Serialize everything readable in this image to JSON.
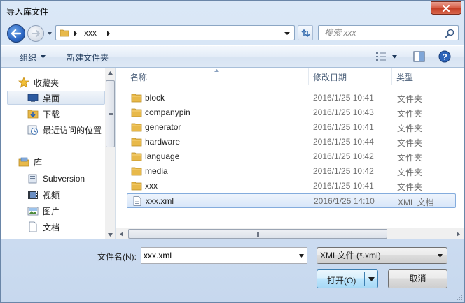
{
  "window": {
    "title": "导入库文件"
  },
  "address": {
    "crumb": "xxx"
  },
  "search": {
    "placeholder": "搜索 xxx"
  },
  "toolbar": {
    "organize_label": "组织",
    "new_folder_label": "新建文件夹"
  },
  "sidebar": {
    "favorites_label": "收藏夹",
    "items": [
      {
        "label": "桌面",
        "icon": "desktop-icon",
        "selected": true
      },
      {
        "label": "下载",
        "icon": "download-folder-icon"
      },
      {
        "label": "最近访问的位置",
        "icon": "recent-places-icon"
      }
    ],
    "libraries_label": "库",
    "library_items": [
      {
        "label": "Subversion",
        "icon": "library-icon"
      },
      {
        "label": "视频",
        "icon": "video-icon"
      },
      {
        "label": "图片",
        "icon": "pictures-icon"
      },
      {
        "label": "文档",
        "icon": "documents-icon"
      }
    ]
  },
  "file_list": {
    "columns": {
      "name": "名称",
      "modified": "修改日期",
      "type": "类型"
    },
    "rows": [
      {
        "name": "block",
        "date": "2016/1/25 10:41",
        "type": "文件夹",
        "icon": "folder-icon"
      },
      {
        "name": "companypin",
        "date": "2016/1/25 10:43",
        "type": "文件夹",
        "icon": "folder-icon"
      },
      {
        "name": "generator",
        "date": "2016/1/25 10:41",
        "type": "文件夹",
        "icon": "folder-icon"
      },
      {
        "name": "hardware",
        "date": "2016/1/25 10:44",
        "type": "文件夹",
        "icon": "folder-icon"
      },
      {
        "name": "language",
        "date": "2016/1/25 10:42",
        "type": "文件夹",
        "icon": "folder-icon"
      },
      {
        "name": "media",
        "date": "2016/1/25 10:42",
        "type": "文件夹",
        "icon": "folder-icon"
      },
      {
        "name": "xxx",
        "date": "2016/1/25 10:41",
        "type": "文件夹",
        "icon": "folder-icon"
      },
      {
        "name": "xxx.xml",
        "date": "2016/1/25 14:10",
        "type": "XML 文档",
        "icon": "xml-file-icon",
        "selected": true
      }
    ]
  },
  "footer": {
    "filename_label": "文件名(N):",
    "filename_value": "xxx.xml",
    "filetype_value": "XML文件 (*.xml)",
    "open_label": "打开(O)",
    "cancel_label": "取消"
  },
  "colors": {
    "accent": "#3c7fb1",
    "folder": "#e8b94a",
    "selection": "#d7e6f9"
  }
}
